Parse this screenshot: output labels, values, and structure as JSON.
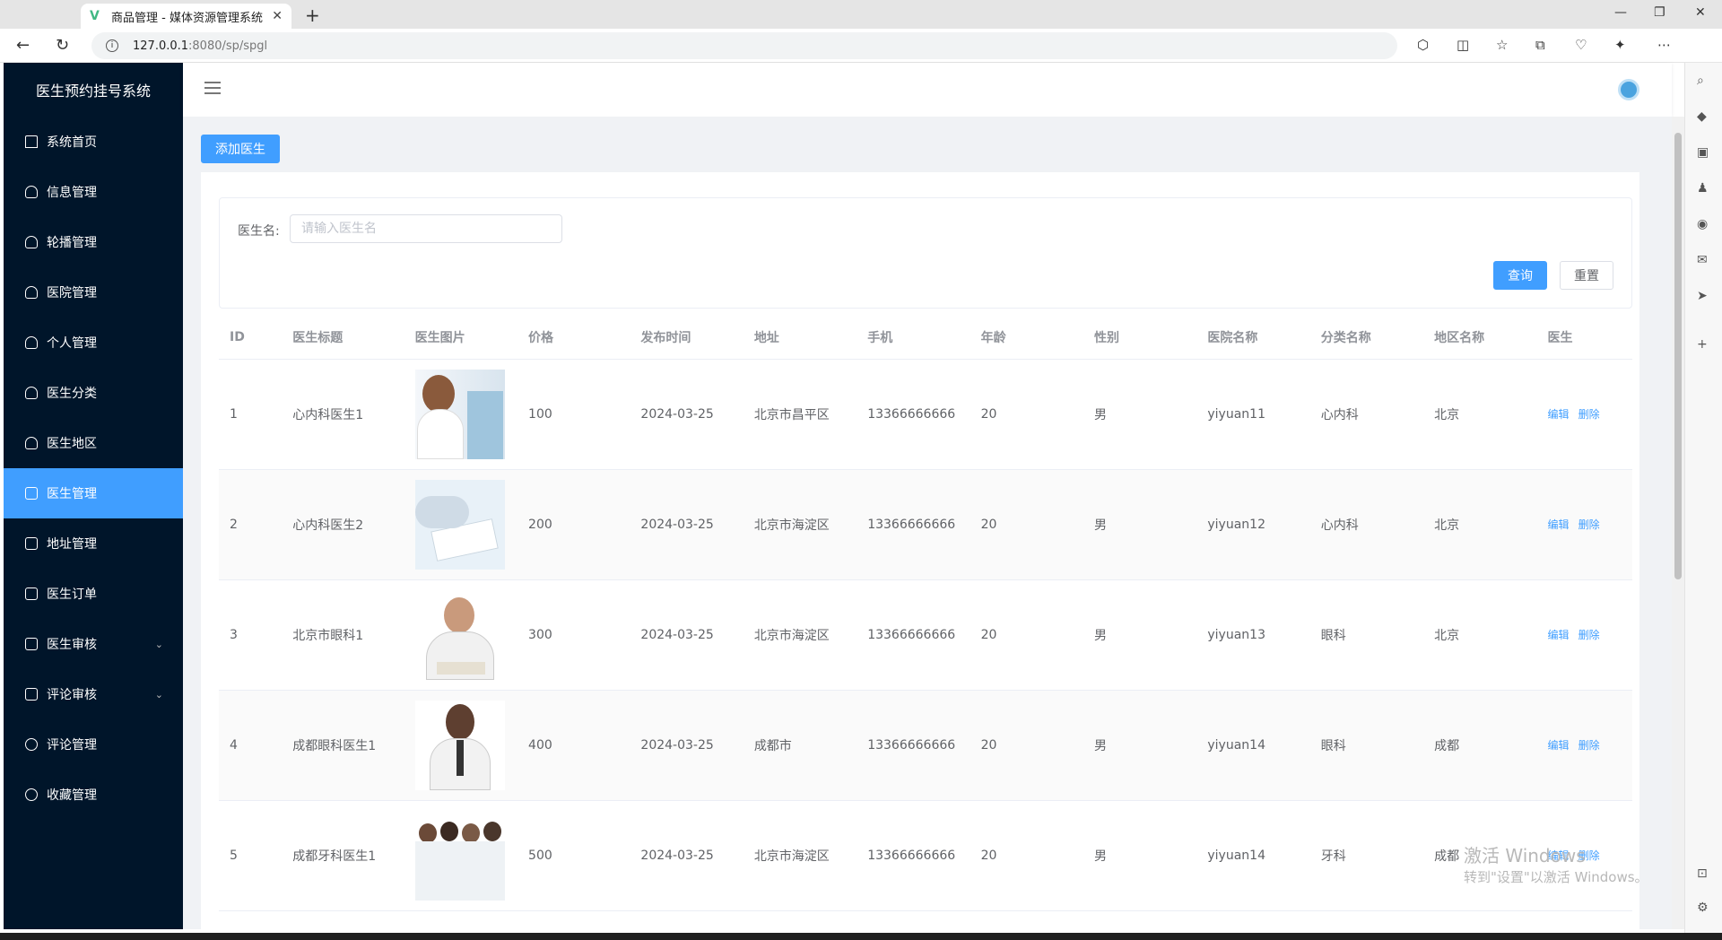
{
  "browser": {
    "tab_title": "商品管理 - 媒体资源管理系统",
    "url_host": "127.0.0.1",
    "url_rest": ":8080/sp/spgl"
  },
  "sidebar": {
    "title": "医生预约挂号系统",
    "items": [
      {
        "label": "系统首页",
        "icon": "home-icon"
      },
      {
        "label": "信息管理",
        "icon": "user-icon"
      },
      {
        "label": "轮播管理",
        "icon": "user-icon"
      },
      {
        "label": "医院管理",
        "icon": "user-icon"
      },
      {
        "label": "个人管理",
        "icon": "user-icon"
      },
      {
        "label": "医生分类",
        "icon": "user-icon"
      },
      {
        "label": "医生地区",
        "icon": "user-icon"
      },
      {
        "label": "医生管理",
        "icon": "document-icon",
        "active": true
      },
      {
        "label": "地址管理",
        "icon": "document-icon"
      },
      {
        "label": "医生订单",
        "icon": "document-icon"
      },
      {
        "label": "医生审核",
        "icon": "document-icon",
        "expandable": true
      },
      {
        "label": "评论审核",
        "icon": "list-icon",
        "expandable": true
      },
      {
        "label": "评论管理",
        "icon": "chat-icon"
      },
      {
        "label": "收藏管理",
        "icon": "chat-icon"
      }
    ]
  },
  "toolbar": {
    "add_label": "添加医生"
  },
  "search": {
    "label": "医生名:",
    "placeholder": "请输入医生名",
    "query_label": "查询",
    "reset_label": "重置"
  },
  "table": {
    "headers": [
      "ID",
      "医生标题",
      "医生图片",
      "价格",
      "发布时间",
      "地址",
      "手机",
      "年龄",
      "性别",
      "医院名称",
      "分类名称",
      "地区名称",
      "医生"
    ],
    "edit_label": "编辑",
    "delete_label": "删除",
    "rows": [
      {
        "id": "1",
        "title": "心内科医生1",
        "price": "100",
        "date": "2024-03-25",
        "address": "北京市昌平区",
        "phone": "13366666666",
        "age": "20",
        "gender": "男",
        "hospital": "yiyuan11",
        "category": "心内科",
        "region": "北京"
      },
      {
        "id": "2",
        "title": "心内科医生2",
        "price": "200",
        "date": "2024-03-25",
        "address": "北京市海淀区",
        "phone": "13366666666",
        "age": "20",
        "gender": "男",
        "hospital": "yiyuan12",
        "category": "心内科",
        "region": "北京"
      },
      {
        "id": "3",
        "title": "北京市眼科1",
        "price": "300",
        "date": "2024-03-25",
        "address": "北京市海淀区",
        "phone": "13366666666",
        "age": "20",
        "gender": "男",
        "hospital": "yiyuan13",
        "category": "眼科",
        "region": "北京"
      },
      {
        "id": "4",
        "title": "成都眼科医生1",
        "price": "400",
        "date": "2024-03-25",
        "address": "成都市",
        "phone": "13366666666",
        "age": "20",
        "gender": "男",
        "hospital": "yiyuan14",
        "category": "眼科",
        "region": "成都"
      },
      {
        "id": "5",
        "title": "成都牙科医生1",
        "price": "500",
        "date": "2024-03-25",
        "address": "北京市海淀区",
        "phone": "13366666666",
        "age": "20",
        "gender": "男",
        "hospital": "yiyuan14",
        "category": "牙科",
        "region": "成都"
      }
    ]
  },
  "watermark": {
    "line1": "激活 Windows",
    "line2": "转到\"设置\"以激活 Windows。"
  }
}
